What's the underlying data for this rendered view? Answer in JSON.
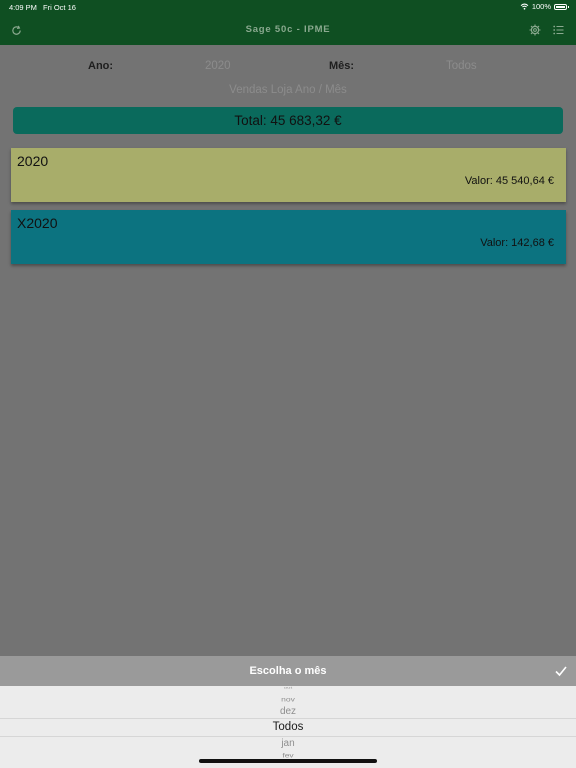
{
  "status_bar": {
    "time": "4:09 PM",
    "date": "Fri Oct 16",
    "battery": "100%"
  },
  "navbar": {
    "title": "Sage 50c - IPME",
    "left_icon": "refresh-icon",
    "right_icons": [
      "gear-icon",
      "list-icon"
    ]
  },
  "filters": {
    "year_label": "Ano:",
    "year_value": "2020",
    "month_label": "Mês:",
    "month_value": "Todos"
  },
  "subtitle": "Vendas Loja Ano / Mês",
  "total": "Total: 45 683,32 €",
  "cards": [
    {
      "name": "2020",
      "amount": "Valor: 45 540,64 €",
      "color": "#a8ad6a"
    },
    {
      "name": "X2020",
      "amount": "Valor: 142,68 €",
      "color": "#0c7380"
    }
  ],
  "picker": {
    "title": "Escolha o mês",
    "done_icon": "checkmark-icon",
    "options": [
      "out",
      "nov",
      "dez",
      "Todos",
      "jan",
      "fev"
    ],
    "selected": "Todos"
  },
  "colors": {
    "header_green": "#0f4f22",
    "total_bar": "#0a6a5c",
    "overlay": "#737373"
  }
}
